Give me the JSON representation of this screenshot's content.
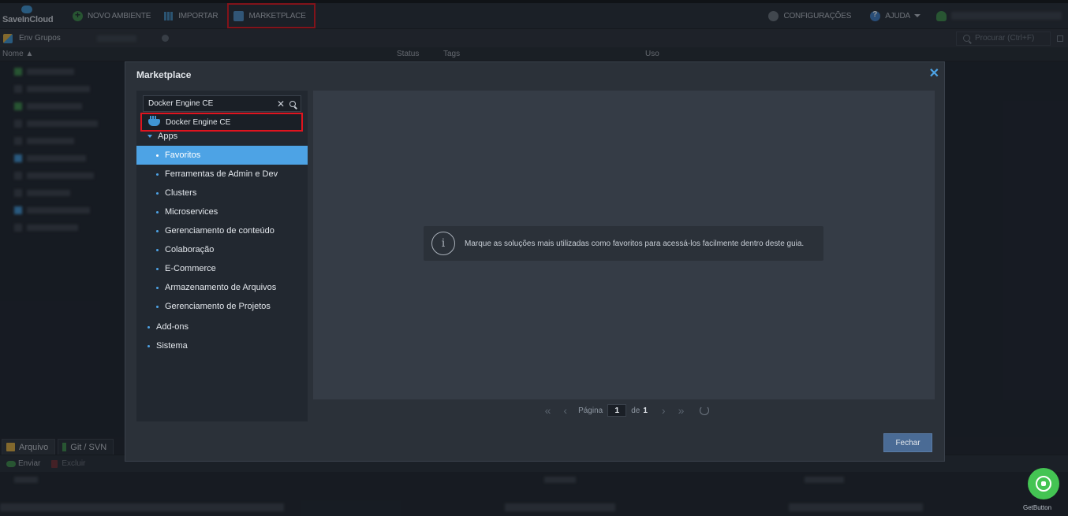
{
  "app": {
    "logo_text": "SaveInCloud"
  },
  "toolbar": {
    "new_env": "NOVO AMBIENTE",
    "import": "IMPORTAR",
    "marketplace": "MARKETPLACE",
    "settings": "CONFIGURAÇÕES",
    "help": "AJUDA"
  },
  "subbar": {
    "env_groups": "Env Grupos",
    "search_placeholder": "Procurar (Ctrl+F)"
  },
  "table_header": {
    "name": "Nome ▲",
    "status": "Status",
    "tags": "Tags",
    "usage": "Uso"
  },
  "bottom_panel": {
    "tab_file": "Arquivo",
    "tab_git": "Git / SVN",
    "send": "Enviar",
    "delete": "Excluir"
  },
  "modal": {
    "title": "Marketplace",
    "search_value": "Docker Engine CE",
    "suggestion": "Docker Engine CE",
    "tree": [
      {
        "label": "Apps",
        "level": 0,
        "expanded": true
      },
      {
        "label": "Favoritos",
        "level": 1,
        "selected": true
      },
      {
        "label": "Ferramentas de Admin e Dev",
        "level": 1
      },
      {
        "label": "Clusters",
        "level": 1
      },
      {
        "label": "Microservices",
        "level": 1
      },
      {
        "label": "Gerenciamento de conteúdo",
        "level": 1
      },
      {
        "label": "Colaboração",
        "level": 1
      },
      {
        "label": "E-Commerce",
        "level": 1
      },
      {
        "label": "Armazenamento de Arquivos",
        "level": 1
      },
      {
        "label": "Gerenciamento de Projetos",
        "level": 1
      },
      {
        "label": "Add-ons",
        "level": 0
      },
      {
        "label": "Sistema",
        "level": 0
      }
    ],
    "info_message": "Marque as soluções mais utilizadas como favoritos para acessá-los facilmente dentro deste guia.",
    "pager": {
      "page_label": "Página",
      "page": "1",
      "of_label": "de",
      "total": "1"
    },
    "close_button": "Fechar"
  },
  "widget": {
    "label": "GetButton"
  },
  "colors": {
    "accent": "#4da3e5",
    "highlight": "#e0141e",
    "whatsapp": "#44c453"
  }
}
